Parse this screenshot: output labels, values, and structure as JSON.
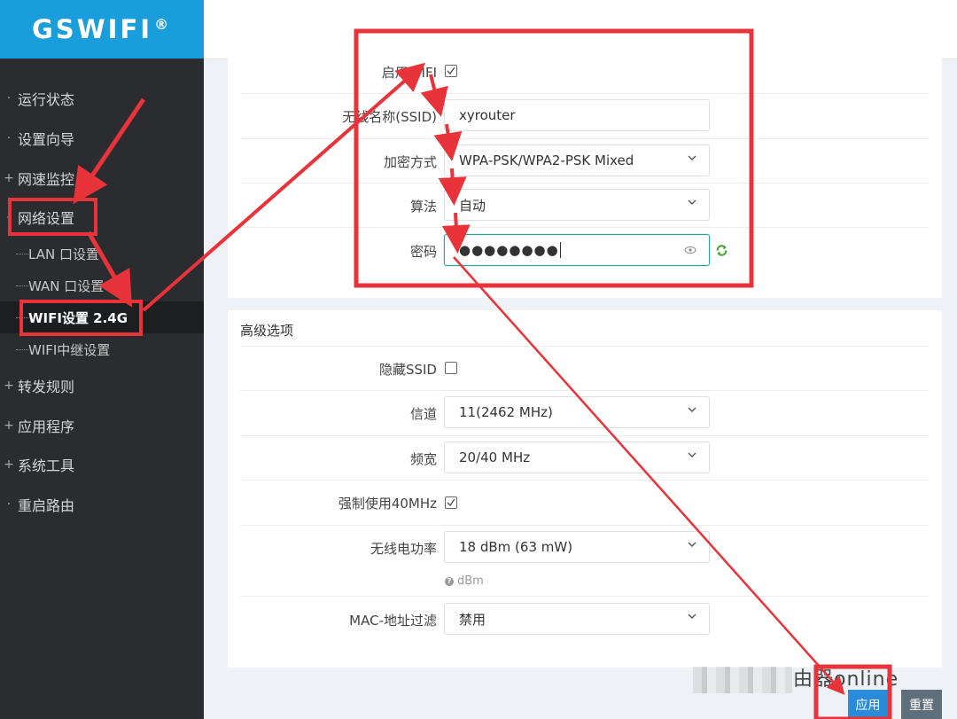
{
  "logo": {
    "text": "GSWIFI",
    "mark": "®"
  },
  "sidebar": {
    "items": [
      {
        "prefix": "·",
        "label": "运行状态"
      },
      {
        "prefix": "·",
        "label": "设置向导"
      },
      {
        "prefix": "+",
        "label": "网速监控"
      },
      {
        "prefix": "-",
        "label": "网络设置"
      },
      {
        "prefix": "+",
        "label": "转发规则"
      },
      {
        "prefix": "+",
        "label": "应用程序"
      },
      {
        "prefix": "+",
        "label": "系统工具"
      },
      {
        "prefix": "·",
        "label": "重启路由"
      }
    ],
    "subitems": [
      {
        "label": "LAN 口设置"
      },
      {
        "label": "WAN 口设置"
      },
      {
        "label": "WIFI设置 2.4G"
      },
      {
        "label": "WIFI中继设置"
      }
    ]
  },
  "basic": {
    "enable_label": "启用WIFI",
    "enable_checked": true,
    "ssid_label": "无线名称(SSID)",
    "ssid_value": "xyrouter",
    "enc_label": "加密方式",
    "enc_value": "WPA-PSK/WPA2-PSK Mixed",
    "algo_label": "算法",
    "algo_value": "自动",
    "pwd_label": "密码",
    "pwd_value": "●●●●●●●●"
  },
  "advanced": {
    "title": "高级选项",
    "hide_ssid_label": "隐藏SSID",
    "hide_ssid_checked": false,
    "channel_label": "信道",
    "channel_value": "11(2462 MHz)",
    "bandwidth_label": "频宽",
    "bandwidth_value": "20/40 MHz",
    "force40_label": "强制使用40MHz",
    "force40_checked": true,
    "power_label": "无线电功率",
    "power_value": "18 dBm (63 mW)",
    "power_hint": "dBm",
    "mac_label": "MAC-地址过滤",
    "mac_value": "禁用"
  },
  "buttons": {
    "apply": "应用",
    "reset": "重置"
  },
  "watermark": "由器online",
  "colors": {
    "brand": "#199edb",
    "sidebar": "#2b2c2f",
    "annotation": "#e8333a",
    "apply": "#2a8bd8",
    "reset": "#5e6f7b",
    "focus": "#23a5a0"
  }
}
